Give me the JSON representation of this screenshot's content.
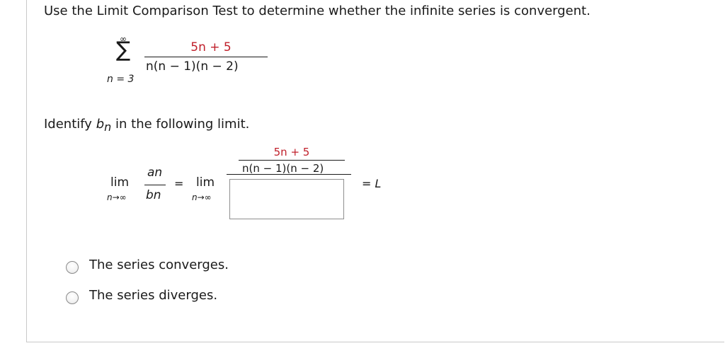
{
  "question": {
    "prompt": "Use the Limit Comparison Test to determine whether the infinite series is convergent."
  },
  "series": {
    "upper_limit": "∞",
    "sigma": "∑",
    "lower_limit": "n = 3",
    "numerator": "5n + 5",
    "denominator": "n(n − 1)(n − 2)"
  },
  "identify": {
    "prefix": "Identify",
    "var": "b",
    "var_sub": "n",
    "suffix": "in the following limit."
  },
  "limit": {
    "lim": "lim",
    "approach": "n→∞",
    "an": "an",
    "bn": "bn",
    "equals": "=",
    "numerator": "5n + 5",
    "denominator": "n(n − 1)(n − 2)",
    "result": "= L"
  },
  "answer_box": {
    "value": ""
  },
  "options": [
    {
      "label": "The series converges.",
      "selected": false
    },
    {
      "label": "The series diverges.",
      "selected": false
    }
  ]
}
